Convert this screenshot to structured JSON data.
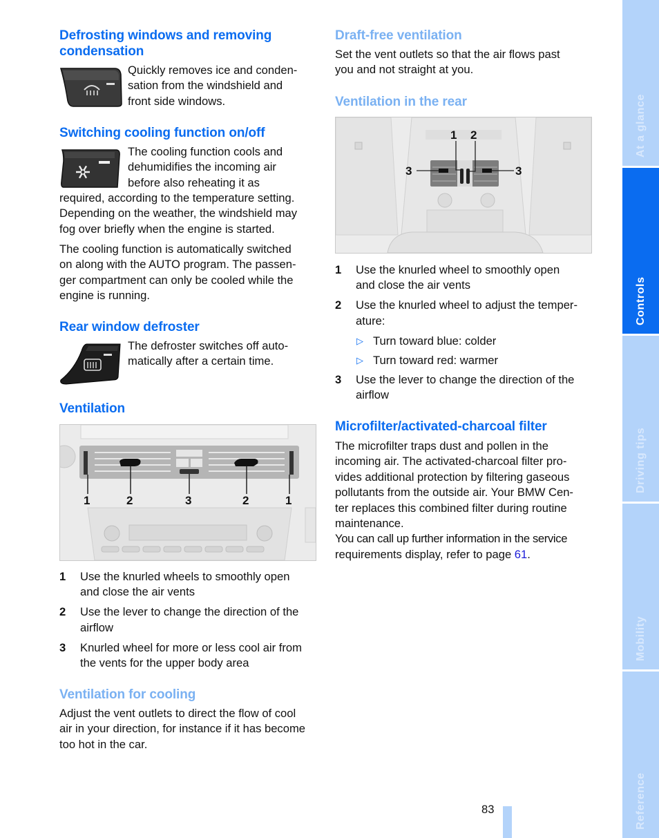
{
  "left": {
    "defrost": {
      "heading": "Defrosting windows and removing condensation",
      "heading_line1": "Defrosting windows and removing",
      "heading_line2": "condensation",
      "icon": "windshield-defrost-button-icon",
      "lines": [
        "Quickly removes ice and conden-",
        "sation from the windshield and",
        "front side windows."
      ]
    },
    "cooling": {
      "heading": "Switching cooling function on/off",
      "icon": "snowflake-button-icon",
      "lines_beside": [
        "The cooling function cools and",
        "dehumidifies the incoming air",
        "before also reheating it as"
      ],
      "lines_after": [
        "required, according to the temperature setting.",
        "Depending on the weather, the windshield may",
        "fog over briefly when the engine is started."
      ],
      "para2": [
        "The cooling function is automatically switched",
        "on along with the AUTO program. The passen-",
        "ger compartment can only be cooled while the",
        "engine is running."
      ]
    },
    "rear_defroster": {
      "heading": "Rear window defroster",
      "icon": "rear-window-defrost-button-icon",
      "lines": [
        "The defroster switches off auto-",
        "matically after a certain time."
      ]
    },
    "ventilation": {
      "heading": "Ventilation",
      "figure_callouts": [
        "1",
        "2",
        "3",
        "2",
        "1"
      ],
      "items": [
        {
          "num": "1",
          "lines": [
            "Use the knurled wheels to smoothly open",
            "and close the air vents"
          ]
        },
        {
          "num": "2",
          "lines": [
            "Use the lever to change the direction of the",
            "airflow"
          ]
        },
        {
          "num": "3",
          "lines": [
            "Knurled wheel for more or less cool air from",
            "the vents for the upper body area"
          ]
        }
      ]
    },
    "ventilation_cooling": {
      "heading": "Ventilation for cooling",
      "lines": [
        "Adjust the vent outlets to direct the flow of cool",
        "air in your direction, for instance if it has become",
        "too hot in the car."
      ]
    }
  },
  "right": {
    "draft_free": {
      "heading": "Draft-free ventilation",
      "lines": [
        "Set the vent outlets so that the air flows past",
        "you and not straight at you."
      ]
    },
    "rear_vent": {
      "heading": "Ventilation in the rear",
      "figure_callouts": [
        "1",
        "2",
        "3",
        "3"
      ],
      "items": [
        {
          "num": "1",
          "lines": [
            "Use the knurled wheel to smoothly open",
            "and close the air vents"
          ]
        },
        {
          "num": "2",
          "lines": [
            "Use the knurled wheel to adjust the temper-",
            "ature:"
          ]
        },
        {
          "num": "3",
          "lines": [
            "Use the lever to change the direction of the",
            "airflow"
          ]
        }
      ],
      "bullets": [
        "Turn toward blue: colder",
        "Turn toward red: warmer"
      ]
    },
    "microfilter": {
      "heading": "Microfilter/activated-charcoal filter",
      "lines": [
        "The microfilter traps dust and pollen in the",
        "incoming air. The activated-charcoal filter pro-",
        "vides additional protection by filtering gaseous",
        "pollutants from the outside air. Your BMW Cen-",
        "ter replaces this combined filter during routine",
        "maintenance."
      ],
      "ref_lines_1": "You can call up further information in the service",
      "ref_prefix": "requirements display, refer to page ",
      "ref_page": "61",
      "ref_suffix": "."
    }
  },
  "sidebar": {
    "tabs": [
      {
        "label": "At a glance",
        "active": false
      },
      {
        "label": "Controls",
        "active": true
      },
      {
        "label": "Driving tips",
        "active": false
      },
      {
        "label": "Mobility",
        "active": false
      },
      {
        "label": "Reference",
        "active": false
      }
    ]
  },
  "footer": {
    "page_number": "83"
  },
  "colors": {
    "heading_blue": "#0a6cf0",
    "heading_light_blue": "#7ab1f2",
    "tab_inactive": "#b3d3fa",
    "tab_active": "#0a6cf0",
    "link": "#1a1ad8"
  }
}
